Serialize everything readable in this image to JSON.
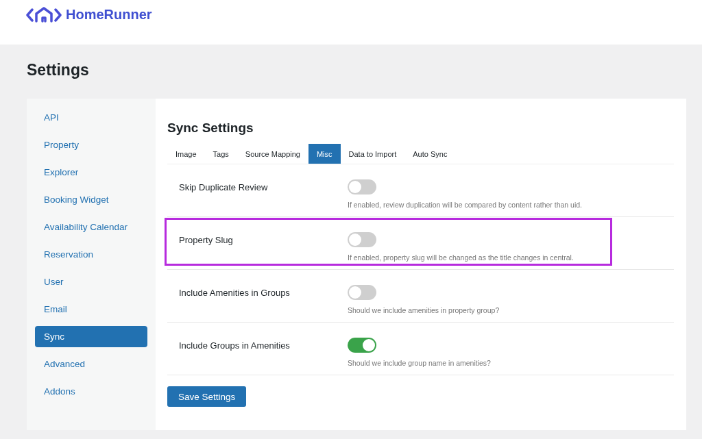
{
  "brand": {
    "name": "HomeRunner"
  },
  "page_title": "Settings",
  "sidebar": {
    "items": [
      {
        "label": "API",
        "selected": false
      },
      {
        "label": "Property",
        "selected": false
      },
      {
        "label": "Explorer",
        "selected": false
      },
      {
        "label": "Booking Widget",
        "selected": false
      },
      {
        "label": "Availability Calendar",
        "selected": false
      },
      {
        "label": "Reservation",
        "selected": false
      },
      {
        "label": "User",
        "selected": false
      },
      {
        "label": "Email",
        "selected": false
      },
      {
        "label": "Sync",
        "selected": true
      },
      {
        "label": "Advanced",
        "selected": false
      },
      {
        "label": "Addons",
        "selected": false
      }
    ]
  },
  "section_title": "Sync Settings",
  "tabs": [
    {
      "label": "Image",
      "selected": false
    },
    {
      "label": "Tags",
      "selected": false
    },
    {
      "label": "Source Mapping",
      "selected": false
    },
    {
      "label": "Misc",
      "selected": true
    },
    {
      "label": "Data to Import",
      "selected": false
    },
    {
      "label": "Auto Sync",
      "selected": false
    }
  ],
  "settings": [
    {
      "label": "Skip Duplicate Review",
      "on": false,
      "highlighted": false,
      "description": "If enabled, review duplication will be compared by content rather than uid."
    },
    {
      "label": "Property Slug",
      "on": false,
      "highlighted": true,
      "description": "If enabled, property slug will be changed as the title changes in central."
    },
    {
      "label": "Include Amenities in Groups",
      "on": false,
      "highlighted": false,
      "description": "Should we include amenities in property group?"
    },
    {
      "label": "Include Groups in Amenities",
      "on": true,
      "highlighted": false,
      "description": "Should we include group name in amenities?"
    }
  ],
  "save_button": "Save Settings"
}
